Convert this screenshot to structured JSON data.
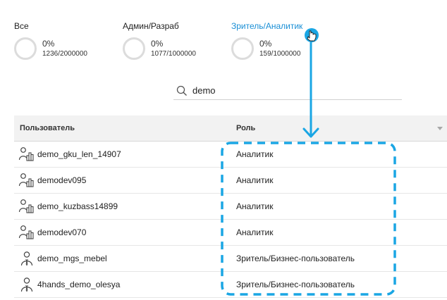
{
  "stats": [
    {
      "label": "Все",
      "percent": "0%",
      "count": "1236/2000000",
      "active": false
    },
    {
      "label": "Админ/Разраб",
      "percent": "0%",
      "count": "1077/1000000",
      "active": false
    },
    {
      "label": "Зритель/Аналитик",
      "percent": "0%",
      "count": "159/1000000",
      "active": true
    }
  ],
  "search": {
    "value": "demo",
    "icon": "search-icon"
  },
  "table": {
    "columns": [
      "Пользователь",
      "Роль"
    ],
    "rows": [
      {
        "user": "demo_gku_len_14907",
        "role": "Аналитик",
        "icon": "analyst-user-icon"
      },
      {
        "user": "demodev095",
        "role": "Аналитик",
        "icon": "analyst-user-icon"
      },
      {
        "user": "demo_kuzbass14899",
        "role": "Аналитик",
        "icon": "analyst-user-icon"
      },
      {
        "user": "demodev070",
        "role": "Аналитик",
        "icon": "analyst-user-icon"
      },
      {
        "user": "demo_mgs_mebel",
        "role": "Зритель/Бизнес-пользователь",
        "icon": "business-user-icon"
      },
      {
        "user": "4hands_demo_olesya",
        "role": "Зритель/Бизнес-пользователь",
        "icon": "business-user-icon"
      }
    ]
  },
  "colors": {
    "accent": "#1a8fd6",
    "annotation": "#1aa6e4",
    "ring": "#dcdcdc",
    "header_bg": "#f2f2f2"
  }
}
